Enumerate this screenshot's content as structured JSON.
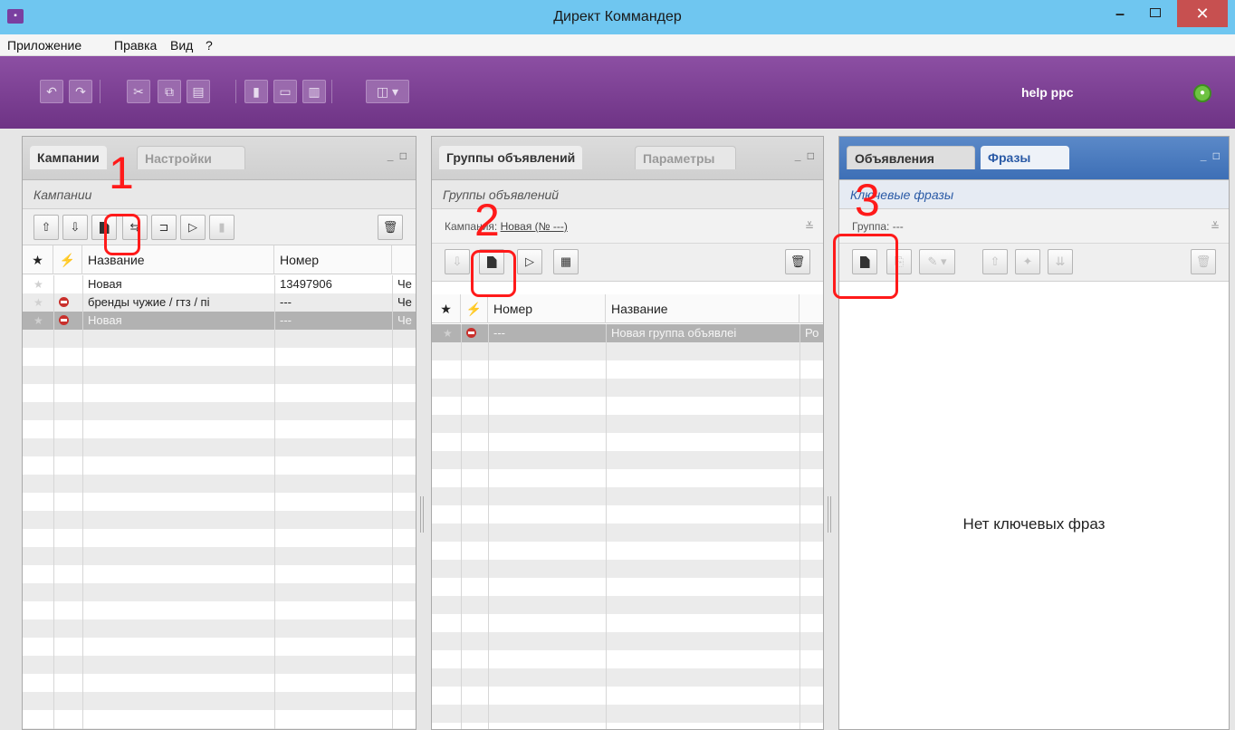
{
  "window": {
    "title": "Директ Коммандер",
    "app_icon": "app-icon",
    "minimize": "–",
    "maximize": "□",
    "close": "✕"
  },
  "menu": [
    "Приложение",
    "Правка",
    "Вид",
    "?"
  ],
  "toolbar": {
    "user": "help ppc",
    "buttons": [
      "undo-icon",
      "redo-icon",
      "cut-icon",
      "copy-icon",
      "paste-icon",
      "chart-icon",
      "banner-icon",
      "table-icon",
      "layout-icon"
    ]
  },
  "campaigns": {
    "tab_active": "Кампании",
    "tab_inactive": "Настройки",
    "subtitle": "Кампании",
    "columns": [
      "★",
      "⚡",
      "Название",
      "Номер"
    ],
    "rows": [
      {
        "name": "Новая",
        "number": "13497906",
        "extra": "Че"
      },
      {
        "name": "бренды чужие / гтз / пі",
        "number": "---",
        "extra": "Че"
      },
      {
        "name": "Новая",
        "number": "---",
        "extra": "Че"
      }
    ]
  },
  "groups": {
    "tab_active": "Группы объявлений",
    "tab_inactive": "Параметры",
    "subtitle": "Группы объявлений",
    "context_label": "Кампания:",
    "context_value": "Новая (№ ---)",
    "columns": [
      "★",
      "⚡",
      "Номер",
      "Название"
    ],
    "rows": [
      {
        "number": "---",
        "name": "Новая группа объявлеі",
        "extra": "Ро"
      }
    ]
  },
  "phrases": {
    "tab_inactive": "Объявления",
    "tab_active": "Фразы",
    "subtitle": "Ключевые фразы",
    "context_label": "Группа:",
    "context_value": "---",
    "empty": "Нет ключевых фраз"
  },
  "annotations": [
    "1",
    "2",
    "3"
  ],
  "colors": {
    "titlebar": "#6fc6f0",
    "toolbar": "#7d3f94",
    "close": "#c75050",
    "annotation": "#ff1a1a",
    "active_tab_phrases": "#3d6fb6"
  }
}
